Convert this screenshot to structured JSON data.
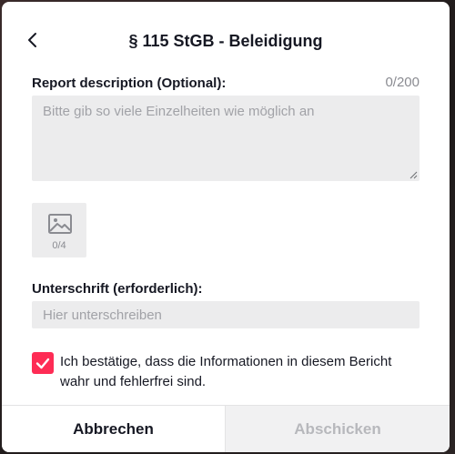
{
  "header": {
    "title": "§ 115 StGB - Beleidigung",
    "back_icon": "chevron-left-icon"
  },
  "description": {
    "label": "Report description (Optional):",
    "counter": "0/200",
    "value": "",
    "placeholder": "Bitte gib so viele Einzelheiten wie möglich an"
  },
  "upload": {
    "icon": "image-icon",
    "count": "0/4"
  },
  "signature": {
    "label": "Unterschrift (erforderlich):",
    "value": "",
    "placeholder": "Hier unterschreiben"
  },
  "confirm": {
    "checked": true,
    "text": "Ich bestätige, dass die Informationen in diesem Bericht wahr und fehlerfrei sind.",
    "accent": "#fe2c55"
  },
  "footer": {
    "cancel_label": "Abbrechen",
    "submit_label": "Abschicken"
  }
}
